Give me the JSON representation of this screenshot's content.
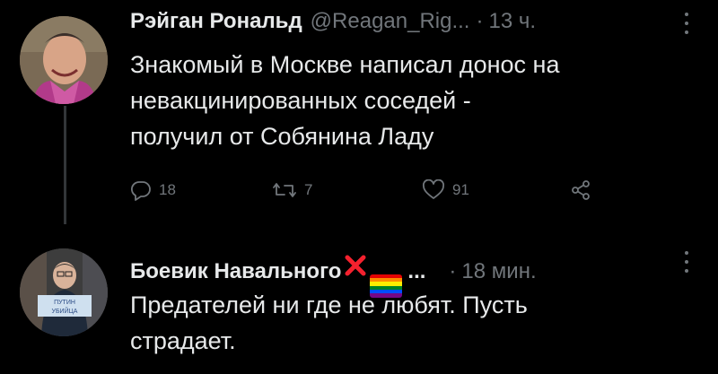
{
  "tweets": [
    {
      "author_name": "Рэйган Рональд",
      "handle": "@Reagan_Rig...",
      "separator": "·",
      "time": "13 ч.",
      "text_lines": [
        "Знакомый в Москве написал донос на",
        "невакцинированных соседей -",
        "получил от Собянина Ладу"
      ],
      "actions": {
        "reply_count": "18",
        "retweet_count": "7",
        "like_count": "91"
      }
    },
    {
      "author_name": "Боевик Навального",
      "name_ellipsis": "...",
      "separator": "·",
      "time": "18 мин.",
      "text_lines": [
        "Предателей ни где не любят. Пусть",
        "страдает."
      ],
      "emoji": [
        "cross-mark-icon",
        "rainbow-flag-icon"
      ],
      "avatar_sign_text": "ПУТИН ... УБИЙЦА"
    }
  ],
  "colors": {
    "background": "#000000",
    "primary_text": "#e7e9ea",
    "secondary_text": "#71767b",
    "thread_line": "#333639",
    "cross_red": "#f4212e"
  }
}
